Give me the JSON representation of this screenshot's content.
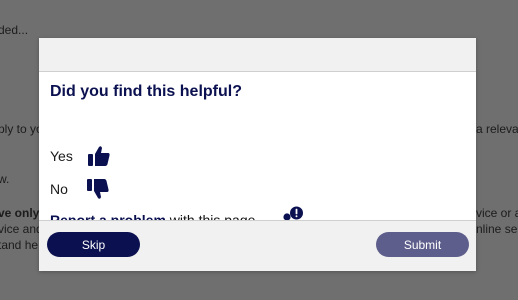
{
  "background_page": {
    "line1": "ded...",
    "line2": "ply to yo",
    "line2_right": "a releva",
    "line3": "w.",
    "line4": "ve only",
    "line4_right": "vice or a",
    "line5": "vice and",
    "line5_right": "nline se",
    "line6": "tand he"
  },
  "feedback": {
    "heading": "Did you find this helpful?",
    "yes_label": "Yes",
    "no_label": "No",
    "report_link": "Report a problem",
    "report_suffix": " with this page"
  },
  "footer": {
    "skip_label": "Skip",
    "submit_label": "Submit"
  },
  "colors": {
    "brand_navy": "#0b1150",
    "submit_disabled": "#5e5e8c",
    "overlay": "#6f6f6f"
  },
  "icons": [
    "thumbs-up-icon",
    "thumbs-down-icon",
    "person-alert-icon"
  ]
}
